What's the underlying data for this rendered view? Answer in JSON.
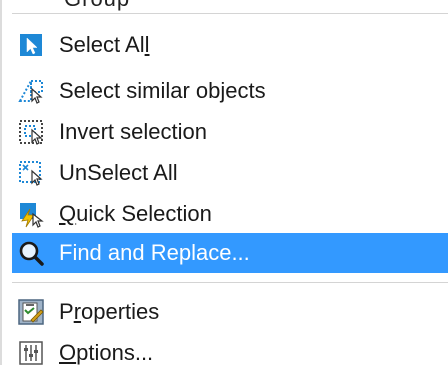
{
  "menu": {
    "partial_top_label": "Group",
    "items": [
      {
        "label": "Select All",
        "mnemonic_pre": "Select Al",
        "mnemonic": "l",
        "mnemonic_post": "",
        "icon": "select-all-icon"
      },
      {
        "label": "Select similar objects",
        "icon": "select-similar-icon"
      },
      {
        "label": "Invert selection",
        "icon": "invert-selection-icon"
      },
      {
        "label": "UnSelect All",
        "icon": "unselect-all-icon"
      },
      {
        "label": "Quick Selection",
        "mnemonic_pre": "",
        "mnemonic": "Q",
        "mnemonic_post": "uick Selection",
        "icon": "quick-selection-icon"
      },
      {
        "label": "Find and Replace...",
        "icon": "find-replace-icon",
        "highlighted": true
      },
      {
        "label": "Properties",
        "mnemonic_pre": "P",
        "mnemonic": "r",
        "mnemonic_post": "operties",
        "icon": "properties-icon"
      },
      {
        "label": "Options...",
        "mnemonic_pre": "",
        "mnemonic": "O",
        "mnemonic_post": "ptions...",
        "icon": "options-icon"
      }
    ]
  },
  "colors": {
    "highlight": "#3399ff",
    "icon_blue": "#1e88d6"
  }
}
